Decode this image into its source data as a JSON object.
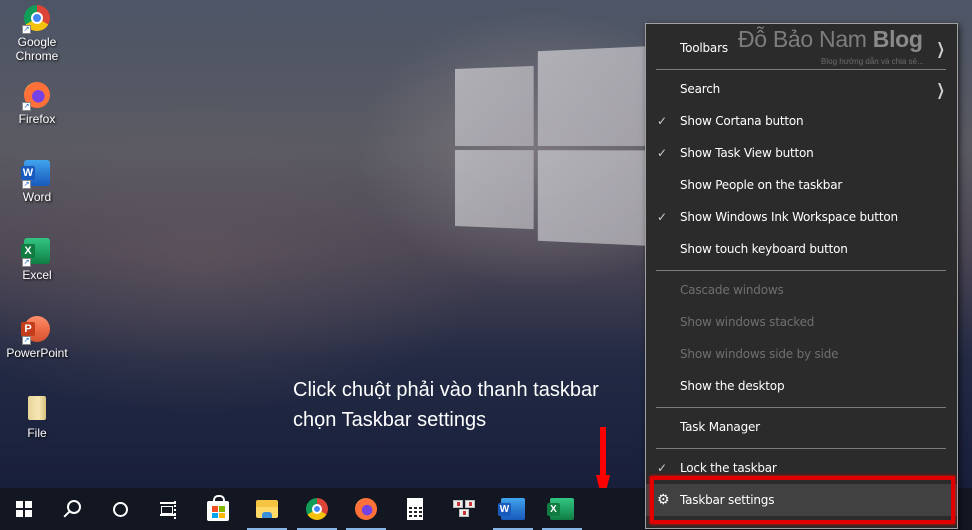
{
  "desktop": {
    "icons": [
      {
        "label_line1": "Google",
        "label_line2": "Chrome",
        "icon": "chrome-icon"
      },
      {
        "label": "Firefox",
        "icon": "firefox-icon"
      },
      {
        "label": "Word",
        "icon": "word-icon",
        "letter": "W"
      },
      {
        "label": "Excel",
        "icon": "excel-icon",
        "letter": "X"
      },
      {
        "label": "PowerPoint",
        "icon": "powerpoint-icon",
        "letter": "P"
      },
      {
        "label": "File",
        "icon": "folder-icon"
      }
    ],
    "shortcut_glyph": "↗"
  },
  "annotation": {
    "line1": "Click chuột phải vào thanh taskbar",
    "line2": "chọn Taskbar settings",
    "arrow_color": "#ff0000"
  },
  "watermark": {
    "name": "Đỗ Bảo Nam ",
    "name_bold": "Blog",
    "tagline": "Blog hướng dẫn và chia sẻ..."
  },
  "context_menu": {
    "chevron": "❯",
    "check": "✓",
    "gear": "⚙",
    "items": [
      {
        "label": "Toolbars",
        "submenu": true,
        "checked": false,
        "enabled": true
      },
      {
        "label": "Search",
        "submenu": true,
        "checked": false,
        "enabled": true
      },
      {
        "label": "Show Cortana button",
        "checked": true,
        "enabled": true
      },
      {
        "label": "Show Task View button",
        "checked": true,
        "enabled": true
      },
      {
        "label": "Show People on the taskbar",
        "checked": false,
        "enabled": true
      },
      {
        "label": "Show Windows Ink Workspace button",
        "checked": true,
        "enabled": true
      },
      {
        "label": "Show touch keyboard button",
        "checked": false,
        "enabled": true
      },
      {
        "label": "Cascade windows",
        "checked": false,
        "enabled": false
      },
      {
        "label": "Show windows stacked",
        "checked": false,
        "enabled": false
      },
      {
        "label": "Show windows side by side",
        "checked": false,
        "enabled": false
      },
      {
        "label": "Show the desktop",
        "checked": false,
        "enabled": true
      },
      {
        "label": "Task Manager",
        "checked": false,
        "enabled": true
      },
      {
        "label": "Lock the taskbar",
        "checked": true,
        "enabled": true
      },
      {
        "label": "Taskbar settings",
        "checked": false,
        "enabled": true,
        "highlighted": true,
        "icon": "gear-icon"
      }
    ],
    "highlight_color": "#e00000"
  },
  "taskbar": {
    "items": [
      {
        "name": "start",
        "active": false
      },
      {
        "name": "search",
        "active": false
      },
      {
        "name": "cortana",
        "active": false
      },
      {
        "name": "task-view",
        "active": false
      },
      {
        "name": "microsoft-store",
        "active": false
      },
      {
        "name": "file-explorer",
        "active": true
      },
      {
        "name": "chrome",
        "active": true
      },
      {
        "name": "firefox",
        "active": true
      },
      {
        "name": "calculator",
        "active": false
      },
      {
        "name": "snipping-tool",
        "active": false
      },
      {
        "name": "word",
        "active": true,
        "letter": "W"
      },
      {
        "name": "excel",
        "active": true,
        "letter": "X"
      }
    ]
  }
}
